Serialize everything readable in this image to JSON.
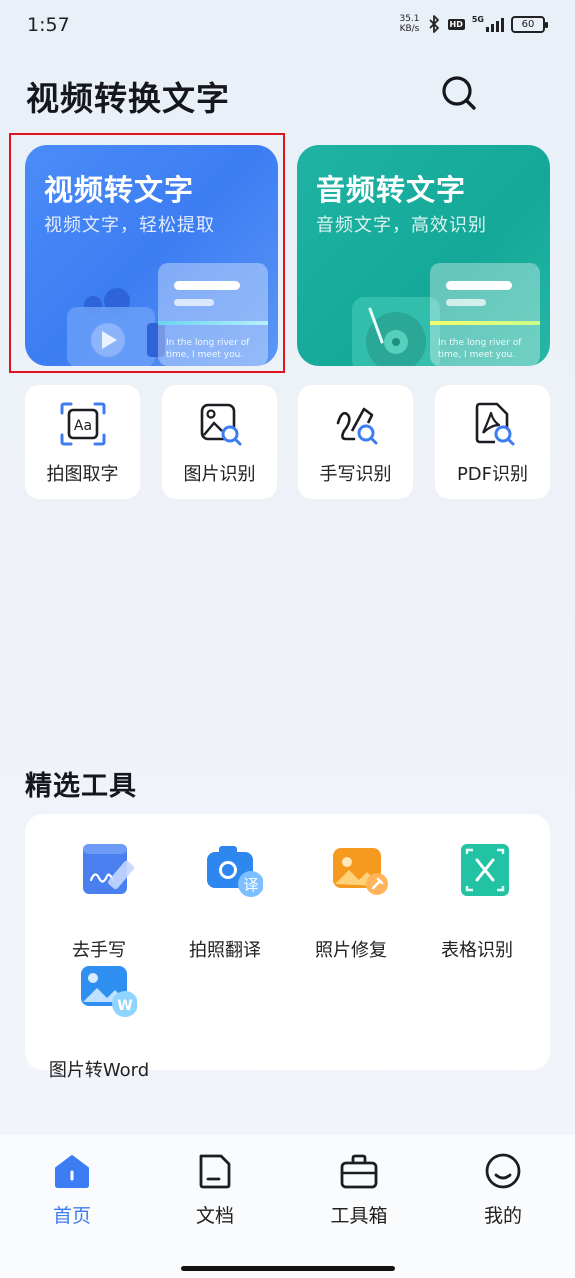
{
  "status_bar": {
    "time": "1:57",
    "net_speed_value": "35.1",
    "net_speed_unit": "KB/s",
    "hd_badge": "HD",
    "network": "5G",
    "battery": "60",
    "icons": [
      "bluetooth-icon",
      "signal-icon",
      "battery-icon"
    ]
  },
  "header": {
    "title": "视频转换文字",
    "search_icon": "search-icon"
  },
  "hero_cards": [
    {
      "title": "视频转文字",
      "subtitle": "视频文字，轻松提取",
      "sample_text": "In the long river of time, I meet you.",
      "color": "#4387f6",
      "selected": true
    },
    {
      "title": "音频转文字",
      "subtitle": "音频文字，高效识别",
      "sample_text": "In the long river of time, I meet you.",
      "color": "#19ad9d",
      "selected": false
    }
  ],
  "quick_tools": [
    {
      "label": "拍图取字",
      "icon": "text-scan-icon"
    },
    {
      "label": "图片识别",
      "icon": "image-search-icon"
    },
    {
      "label": "手写识别",
      "icon": "handwriting-search-icon"
    },
    {
      "label": "PDF识别",
      "icon": "pdf-search-icon"
    }
  ],
  "featured": {
    "title": "精选工具",
    "items": [
      {
        "label": "去手写",
        "icon": "remove-handwriting-icon"
      },
      {
        "label": "拍照翻译",
        "icon": "camera-translate-icon",
        "badge": "译"
      },
      {
        "label": "照片修复",
        "icon": "photo-repair-icon"
      },
      {
        "label": "表格识别",
        "icon": "table-recognition-icon"
      },
      {
        "label": "图片转Word",
        "icon": "image-to-word-icon",
        "badge": "W"
      }
    ]
  },
  "bottom_nav": [
    {
      "label": "首页",
      "icon": "home-icon",
      "active": true
    },
    {
      "label": "文档",
      "icon": "document-icon",
      "active": false
    },
    {
      "label": "工具箱",
      "icon": "toolbox-icon",
      "active": false
    },
    {
      "label": "我的",
      "icon": "profile-icon",
      "active": false
    }
  ],
  "colors": {
    "accent": "#3c7df3",
    "teal": "#19ad9d",
    "selection": "#e0141c"
  }
}
